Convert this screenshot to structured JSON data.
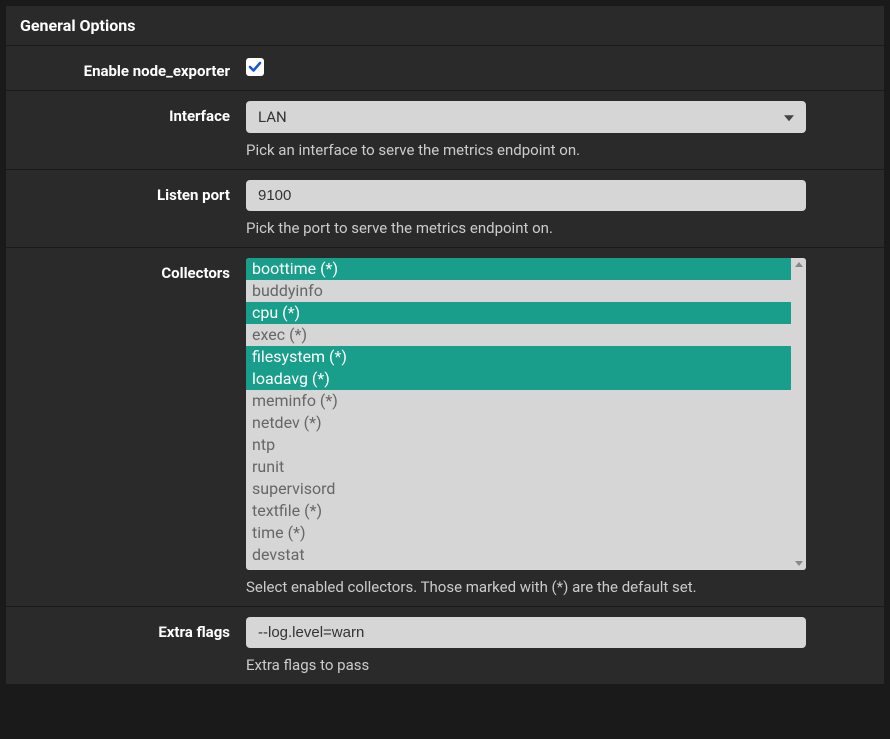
{
  "panel": {
    "title": "General Options"
  },
  "fields": {
    "enable": {
      "label": "Enable node_exporter",
      "checked": true
    },
    "interface": {
      "label": "Interface",
      "value": "LAN",
      "help": "Pick an interface to serve the metrics endpoint on."
    },
    "listen_port": {
      "label": "Listen port",
      "value": "9100",
      "help": "Pick the port to serve the metrics endpoint on."
    },
    "collectors": {
      "label": "Collectors",
      "help": "Select enabled collectors. Those marked with (*) are the default set.",
      "options": [
        {
          "label": "boottime (*)",
          "selected": true
        },
        {
          "label": "buddyinfo",
          "selected": false
        },
        {
          "label": "cpu (*)",
          "selected": true
        },
        {
          "label": "exec (*)",
          "selected": false
        },
        {
          "label": "filesystem (*)",
          "selected": true
        },
        {
          "label": "loadavg (*)",
          "selected": true
        },
        {
          "label": "meminfo (*)",
          "selected": false
        },
        {
          "label": "netdev (*)",
          "selected": false
        },
        {
          "label": "ntp",
          "selected": false
        },
        {
          "label": "runit",
          "selected": false
        },
        {
          "label": "supervisord",
          "selected": false
        },
        {
          "label": "textfile (*)",
          "selected": false
        },
        {
          "label": "time (*)",
          "selected": false
        },
        {
          "label": "devstat",
          "selected": false
        }
      ]
    },
    "extra_flags": {
      "label": "Extra flags",
      "value": "--log.level=warn",
      "help": "Extra flags to pass"
    }
  }
}
